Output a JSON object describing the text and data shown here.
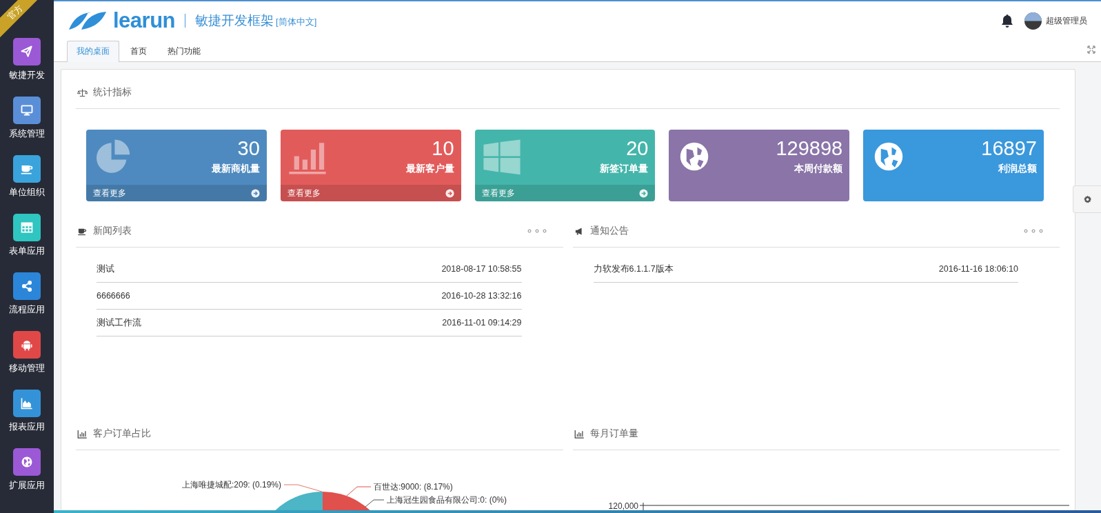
{
  "sidebar": {
    "badge": "官方",
    "items": [
      {
        "label": "敏捷开发",
        "kind": "plane",
        "color": "#9b59d6"
      },
      {
        "label": "系统管理",
        "kind": "monitor",
        "color": "#5a8fd8"
      },
      {
        "label": "单位组织",
        "kind": "cup",
        "color": "#3aa3dc"
      },
      {
        "label": "表单应用",
        "kind": "grid",
        "color": "#2fc5c0"
      },
      {
        "label": "流程应用",
        "kind": "share",
        "color": "#2b86d9"
      },
      {
        "label": "移动管理",
        "kind": "android",
        "color": "#e04848"
      },
      {
        "label": "报表应用",
        "kind": "area",
        "color": "#3493d8"
      },
      {
        "label": "扩展应用",
        "kind": "globe",
        "color": "#9b59d6"
      }
    ]
  },
  "header": {
    "logo": "learun",
    "title": "敏捷开发框架",
    "language": "[简体中文]",
    "user": "超级管理员"
  },
  "tabs": [
    {
      "label": "我的桌面",
      "selected": true
    },
    {
      "label": "首页",
      "selected": false
    },
    {
      "label": "热门功能",
      "selected": false
    }
  ],
  "stats": {
    "title": "统计指标",
    "cards": [
      {
        "value": "30",
        "label": "最新商机量",
        "kind": "pie",
        "color": "#4e8abf",
        "more": "查看更多"
      },
      {
        "value": "10",
        "label": "最新客户量",
        "kind": "bars",
        "color": "#e25b5b",
        "more": "查看更多"
      },
      {
        "value": "20",
        "label": "新签订单量",
        "kind": "windows",
        "color": "#44b5aa",
        "more": "查看更多"
      },
      {
        "value": "129898",
        "label": "本周付款额",
        "kind": "globe",
        "color": "#8a74a8"
      },
      {
        "value": "16897",
        "label": "利润总额",
        "kind": "globe",
        "color": "#3a98dc"
      }
    ]
  },
  "news": {
    "title": "新闻列表",
    "rows": [
      {
        "title": "测试",
        "time": "2018-08-17 10:58:55"
      },
      {
        "title": "6666666",
        "time": "2016-10-28 13:32:16"
      },
      {
        "title": "测试工作流",
        "time": "2016-11-01 09:14:29"
      }
    ]
  },
  "notices": {
    "title": "通知公告",
    "rows": [
      {
        "title": "力软发布6.1.1.7版本",
        "time": "2016-11-16 18:06:10"
      }
    ]
  },
  "order_share": {
    "title": "客户订单占比",
    "labels": [
      "上海唯捷城配:209: (0.19%)",
      "百世达:9000: (8.17%)",
      "上海冠生园食品有限公司:0: (0%)"
    ]
  },
  "monthly_orders": {
    "title": "每月订单量",
    "tick": "120,000"
  }
}
